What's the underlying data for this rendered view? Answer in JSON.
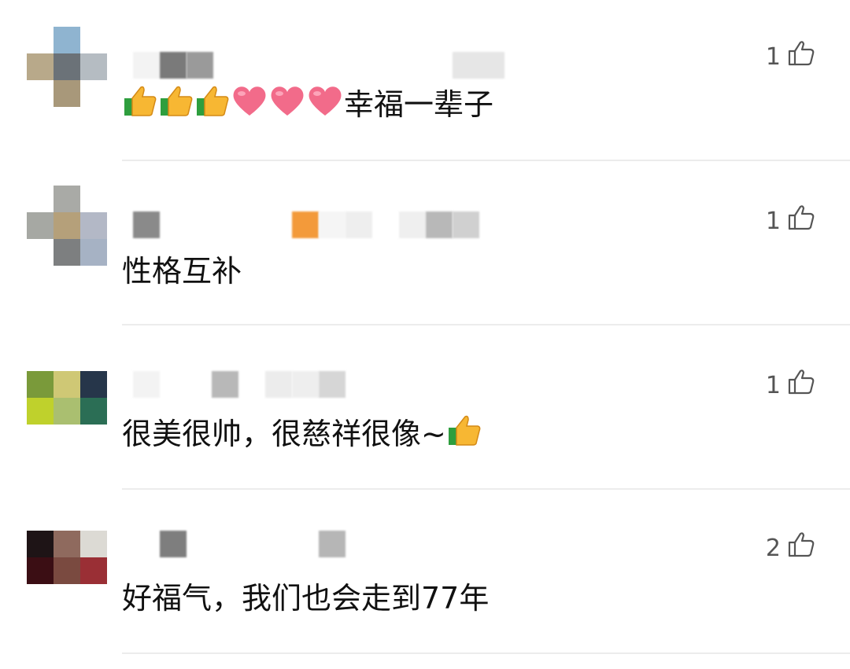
{
  "comments": [
    {
      "text": "幸福一辈子",
      "emoji_prefix": [
        "thumbs-up",
        "thumbs-up",
        "thumbs-up",
        "heart",
        "heart",
        "heart"
      ],
      "like_count": "1",
      "avatar_colors": [
        "#8fb4d0",
        "#b8a98a",
        "#6b7278",
        "#b5bcc2",
        "#a8987a"
      ],
      "name_blur_colors": [
        "#f3f3f3",
        "#7a7a7a",
        "#9a9a9a",
        "#e6e6e6"
      ]
    },
    {
      "text": "性格互补",
      "like_count": "1",
      "avatar_colors": [
        "#a9aaa6",
        "#a6a8a3",
        "#b5a07a",
        "#b3b8c6",
        "#7d7f80",
        "#a6b2c4"
      ],
      "name_blur_colors": [
        "#8a8a8a",
        "#f39a3a",
        "#f5f5f5",
        "#eeeeee",
        "#efefef",
        "#b8b8b8",
        "#d0d0d0"
      ]
    },
    {
      "text": "很美很帅，很慈祥很像~",
      "emoji_suffix": [
        "thumbs-up"
      ],
      "like_count": "1",
      "avatar_colors": [
        "#7a9a3a",
        "#cfc875",
        "#26364a",
        "#bfd12c",
        "#aabf70",
        "#2b6e55"
      ],
      "name_blur_colors": [
        "#f3f3f3",
        "#b8b8b8",
        "#ececec",
        "#eeeeee",
        "#d6d6d6"
      ]
    },
    {
      "text": "好福气，我们也会走到77年",
      "like_count": "2",
      "avatar_colors": [
        "#1e1416",
        "#8f6a5e",
        "#dcdad4",
        "#3b0e14",
        "#7a4a40",
        "#9a2f35"
      ],
      "name_blur_colors": [
        "#7e7e7e",
        "#b6b6b6"
      ]
    }
  ],
  "colors": {
    "text": "#111111",
    "like": "#555555",
    "divider": "#ececec",
    "heart": "#f26b8a",
    "thumb": "#f7b733",
    "cuff": "#2e9e3e"
  },
  "icons": {
    "like": "thumbs-up-outline-icon",
    "emoji_thumb": "thumbs-up-emoji",
    "emoji_heart": "heart-emoji"
  }
}
